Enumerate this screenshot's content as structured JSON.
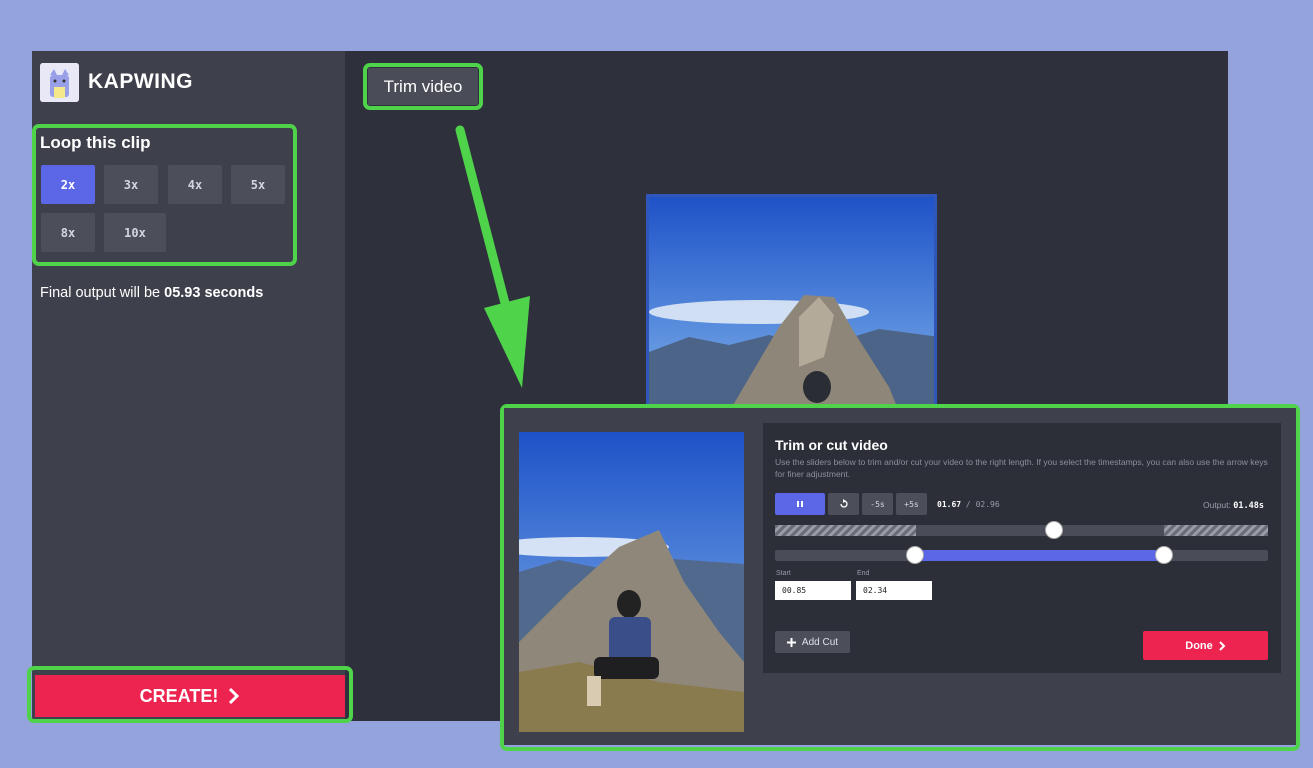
{
  "brand": {
    "name": "KAPWING"
  },
  "loop": {
    "title": "Loop this clip",
    "options": [
      "2x",
      "3x",
      "4x",
      "5x",
      "8x",
      "10x"
    ],
    "selected": "2x"
  },
  "summary": {
    "prefix": "Final output will be",
    "value": "05.93 seconds"
  },
  "create_button": {
    "label": "CREATE!"
  },
  "annotation": {
    "label": "Trim video"
  },
  "trim_panel": {
    "title": "Trim or cut video",
    "description": "Use the sliders below to trim and/or cut your video to the right length. If you select the timestamps, you can also use the arrow keys for finer adjustment.",
    "controls": {
      "minus5": "-5s",
      "plus5": "+5s"
    },
    "current_time": "01.67",
    "separator": "/",
    "total_time": "02.96",
    "output_label": "Output:",
    "output_value": "01.48s",
    "start_label": "Start",
    "start_value": "00.85",
    "end_label": "End",
    "end_value": "02.34",
    "add_cut": "Add Cut",
    "done": "Done"
  },
  "icons": {
    "pause": "pause-icon",
    "restart": "restart-icon",
    "plus": "plus-icon",
    "chevron": "chevron-right-icon",
    "logo": "cat-logo-icon"
  },
  "colors": {
    "accent": "#5b67e6",
    "create": "#ee2450",
    "highlight": "#4fd34b"
  }
}
